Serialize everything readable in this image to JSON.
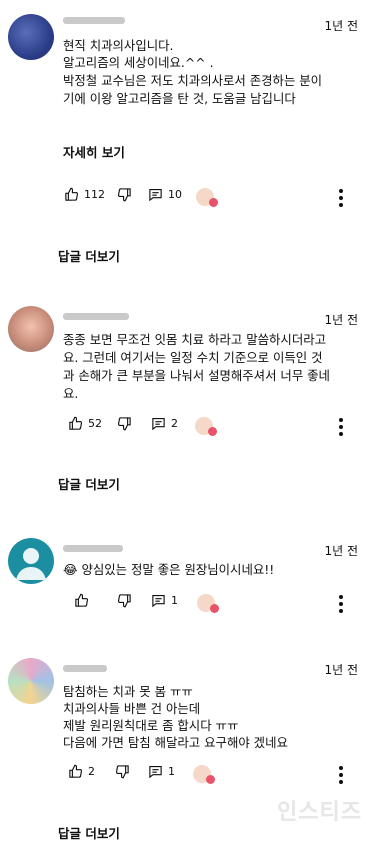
{
  "comments": [
    {
      "time": "1년 전",
      "lines": [
        "현직 치과의사입니다.",
        "알고리즘의 세상이네요.^^ .",
        "박정철 교수님은 저도 치과의사로서  존경하는 분이",
        "기에  이왕 알고리즘을 탄 것,  도움글 남깁니다"
      ],
      "more": "자세히 보기",
      "likes": "112",
      "replies_count": "10",
      "replies_label": "답글 더보기"
    },
    {
      "time": "1년 전",
      "lines": [
        "종종 보면 무조건 잇몸 치료 하라고 말씀하시더라고",
        "요. 그런데 여기서는 일정 수치 기준으로 이득인 것",
        "과 손해가 큰 부분을 나눠서 설명해주셔서 너무 좋네",
        "요."
      ],
      "likes": "52",
      "replies_count": "2",
      "replies_label": "답글 더보기"
    },
    {
      "time": "1년 전",
      "lines": [
        "양심있는 정말 좋은 원장님이시네요!!"
      ],
      "emoji": "😂",
      "replies_count": "1"
    },
    {
      "time": "1년 전",
      "lines": [
        "탐침하는 치과 못 봄 ㅠㅠ",
        "치과의사들 바쁜 건 아는데",
        "제발 원리원칙대로 좀 합시다 ㅠㅠ",
        "다음에 가면 탐침 해달라고 요구해야 겠네요"
      ],
      "likes": "2",
      "replies_count": "1",
      "replies_label": "답글 더보기"
    }
  ],
  "watermark": "인스티즈",
  "colors": {
    "text": "#0f0f0f",
    "secondary": "#606060",
    "heart": "#e8536b"
  }
}
